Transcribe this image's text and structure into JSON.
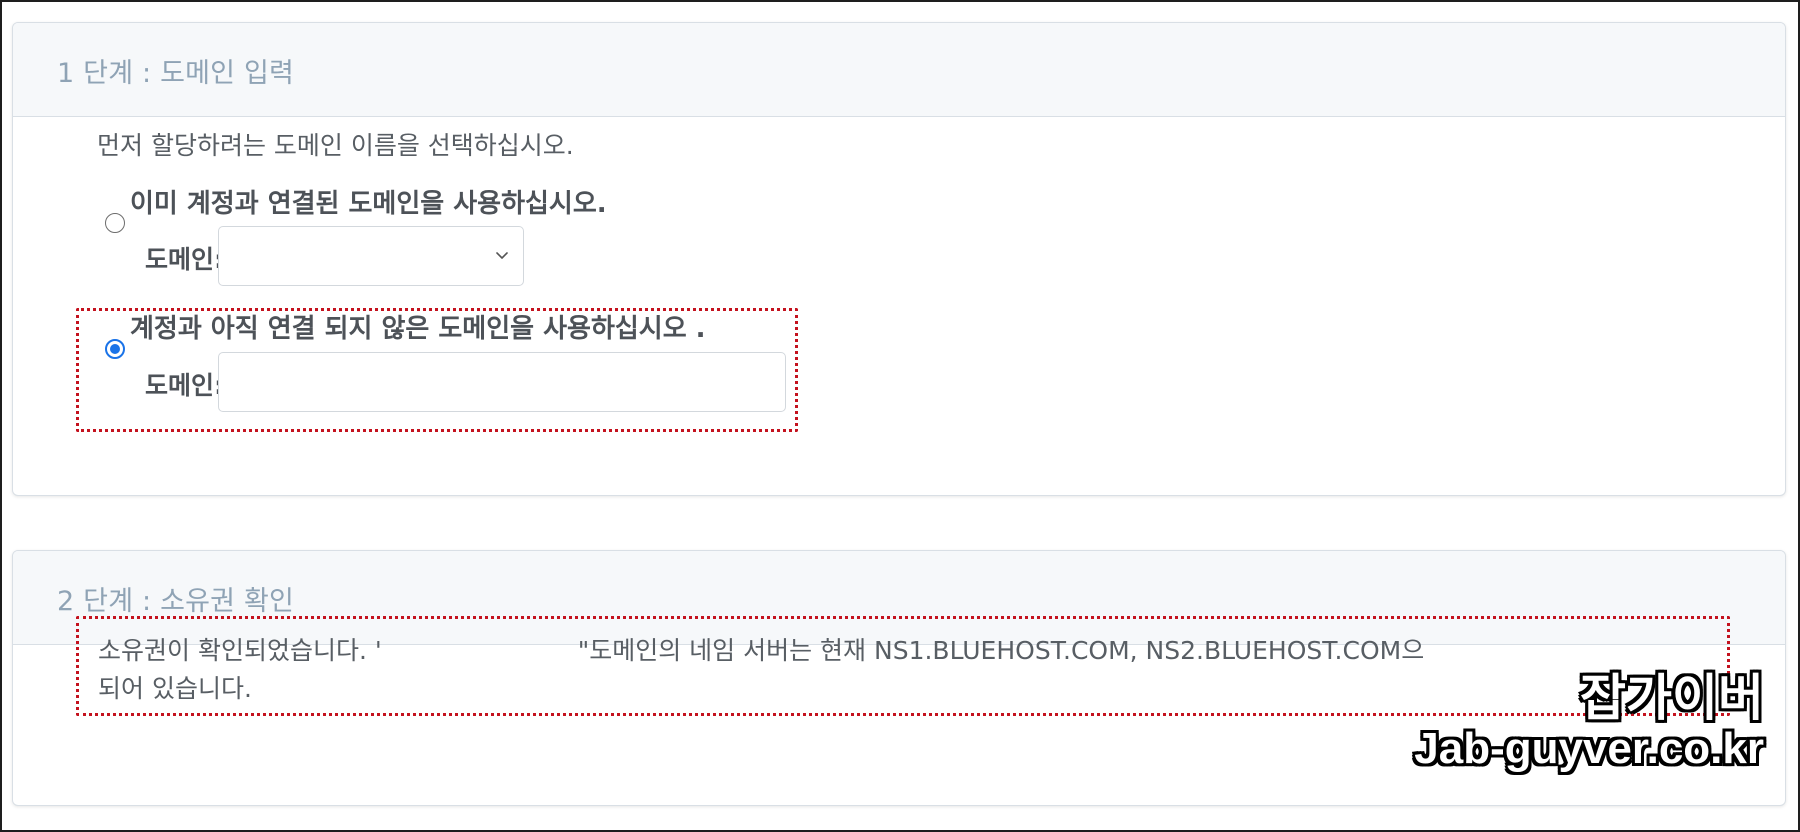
{
  "step1": {
    "title": "1 단계 : 도메인 입력",
    "intro": "먼저 할당하려는 도메인 이름을 선택하십시오.",
    "option_existing": {
      "label": "이미 계정과 연결된 도메인을 사용하십시오.",
      "field_label": "도메인:",
      "selected_value": "",
      "checked": false
    },
    "option_new": {
      "label": "계정과 아직 연결 되지 않은 도메인을 사용하십시오 .",
      "field_label": "도메인:",
      "value": "",
      "checked": true
    }
  },
  "step2": {
    "title": "2 단계 : 소유권 확인",
    "message_part1": "소유권이 확인되었습니다. '",
    "message_part2": "\"도메인의 네임 서버는 현재 NS1.BLUEHOST.COM, NS2.BLUEHOST.COM으",
    "message_line2": "되어 있습니다."
  },
  "watermark": {
    "korean": "잡가이버",
    "url": "Jab-guyver.co.kr"
  },
  "colors": {
    "accent": "#1a73e8",
    "highlight_border": "#c4121e",
    "panel_header_bg": "#f6f8fa",
    "title_text": "#8fa3b5"
  }
}
